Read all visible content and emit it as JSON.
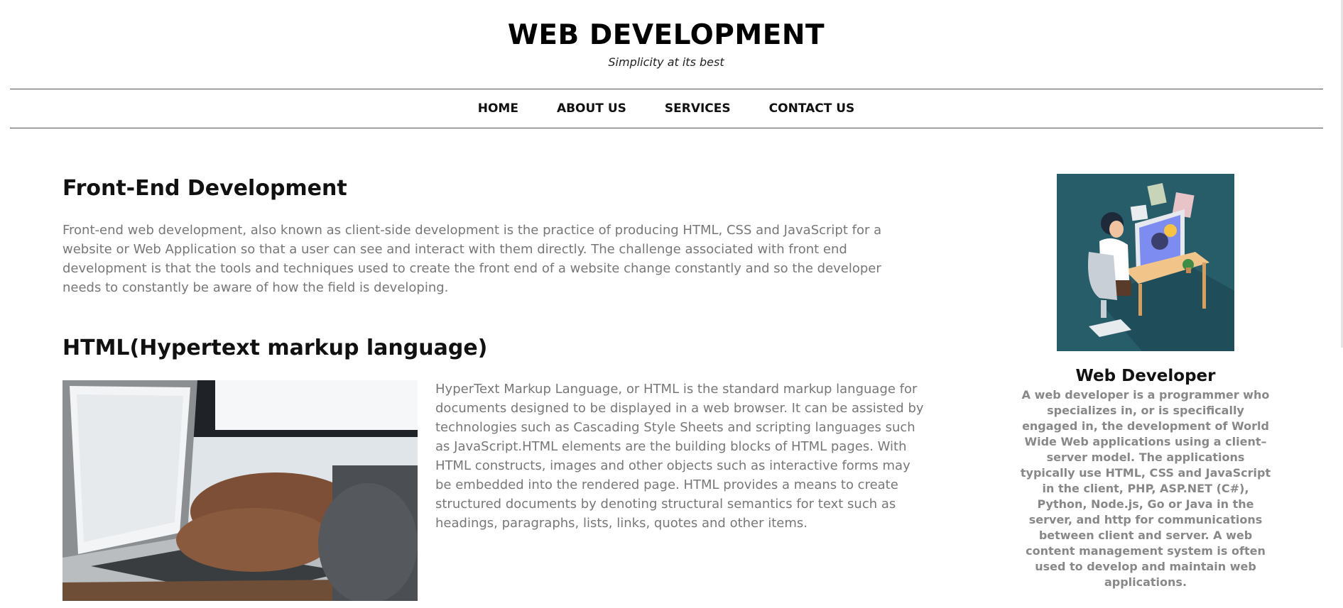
{
  "header": {
    "title": "WEB DEVELOPMENT",
    "tagline": "Simplicity at its best"
  },
  "nav": {
    "items": [
      {
        "label": "HOME"
      },
      {
        "label": "ABOUT US"
      },
      {
        "label": "SERVICES"
      },
      {
        "label": "CONTACT US"
      }
    ]
  },
  "main": {
    "front_end": {
      "title": "Front-End Development",
      "text": "Front-end web development, also known as client-side development is the practice of producing HTML, CSS and JavaScript for a website or Web Application so that a user can see and interact with them directly. The challenge associated with front end development is that the tools and techniques used to create the front end of a website change constantly and so the developer needs to constantly be aware of how the field is developing."
    },
    "html_section": {
      "title": "HTML(Hypertext markup language)",
      "text": "HyperText Markup Language, or HTML is the standard markup language for documents designed to be displayed in a web browser. It can be assisted by technologies such as Cascading Style Sheets and scripting languages such as JavaScript.HTML elements are the building blocks of HTML pages. With HTML constructs, images and other objects such as interactive forms may be embedded into the rendered page. HTML provides a means to create structured documents by denoting structural semantics for text such as headings, paragraphs, lists, links, quotes and other items."
    }
  },
  "sidebar": {
    "name": "Web Developer",
    "description": "A web developer is a programmer who specializes in, or is specifically engaged in, the development of World Wide Web applications using a client–server model. The applications typically use HTML, CSS and JavaScript in the client, PHP, ASP.NET (C#), Python, Node.js, Go or Java in the server, and http for communications between client and server. A web content management system is often used to develop and maintain web applications."
  },
  "colors": {
    "nav_rule": "#555555",
    "body_text": "#777777",
    "card_bg": "#275c69"
  }
}
